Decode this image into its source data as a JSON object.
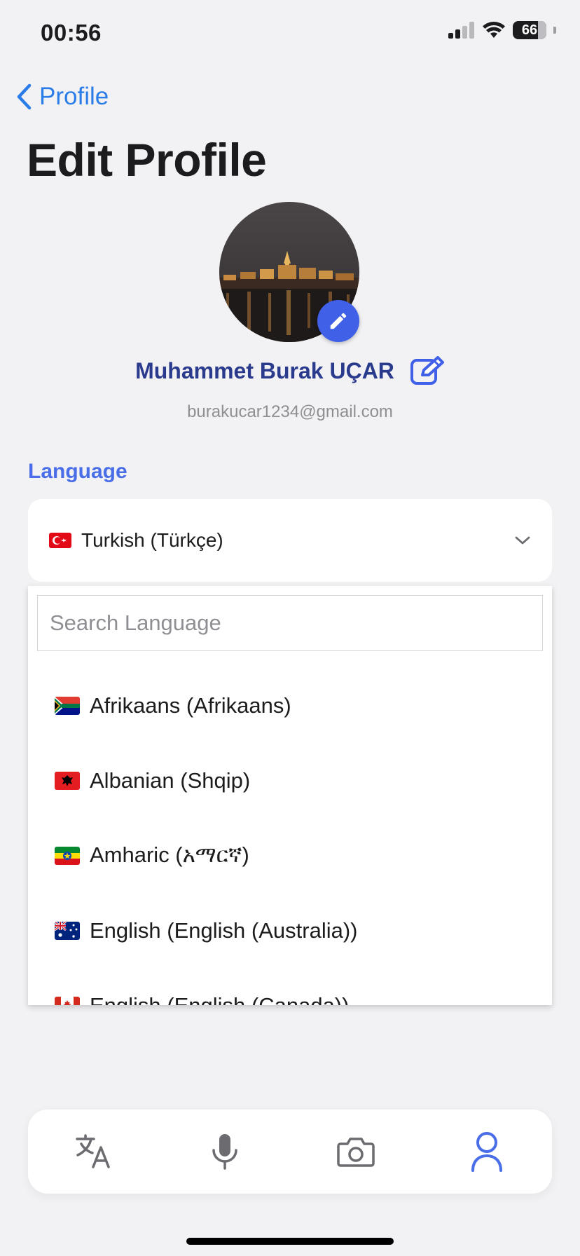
{
  "status_bar": {
    "time": "00:56",
    "battery": "66"
  },
  "nav": {
    "back_label": "Profile",
    "title": "Edit Profile"
  },
  "profile": {
    "name": "Muhammet Burak UÇAR",
    "email": "burakucar1234@gmail.com"
  },
  "language": {
    "section_label": "Language",
    "selected": "Turkish (Türkçe)",
    "search_placeholder": "Search Language",
    "options": [
      {
        "label": "Afrikaans (Afrikaans)",
        "flag": "south-africa-flag"
      },
      {
        "label": "Albanian (Shqip)",
        "flag": "albania-flag"
      },
      {
        "label": "Amharic (አማርኛ)",
        "flag": "ethiopia-flag"
      },
      {
        "label": "English (English (Australia))",
        "flag": "australia-flag"
      },
      {
        "label": "English (English (Canada))",
        "flag": "canada-flag"
      }
    ]
  },
  "tabbar": {
    "tabs": [
      {
        "icon": "translate-icon",
        "active": false
      },
      {
        "icon": "microphone-icon",
        "active": false
      },
      {
        "icon": "camera-icon",
        "active": false
      },
      {
        "icon": "profile-icon",
        "active": true
      }
    ]
  },
  "colors": {
    "accent": "#4a6ee8",
    "link": "#2a7de8",
    "name": "#2a3a8c",
    "inactive_icon": "#6b6b70"
  }
}
